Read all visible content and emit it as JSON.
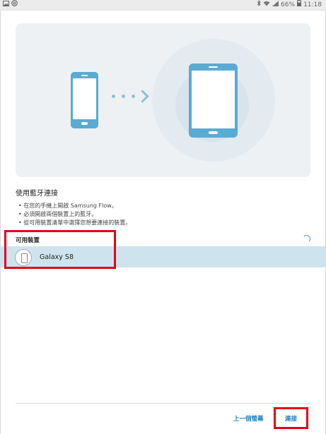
{
  "status_bar": {
    "battery": "66%",
    "time": "11:18"
  },
  "instructions": {
    "title": "使用藍牙連接",
    "bullets": [
      "• 在您的手機上開啟 Samsung Flow。",
      "• 必須開啟兩個裝置上的藍牙。",
      "• 從可用裝置清單中選擇您想要連接的裝置。"
    ]
  },
  "devices": {
    "section_label": "可用裝置",
    "items": [
      {
        "name": "Galaxy S8"
      }
    ]
  },
  "footer": {
    "prev_label": "上一個螢幕",
    "connect_label": "連接"
  },
  "colors": {
    "accent": "#1f7fc0",
    "device_blue": "#5aaad1",
    "selected_row": "#cde4ee",
    "highlight": "#e3001b"
  }
}
